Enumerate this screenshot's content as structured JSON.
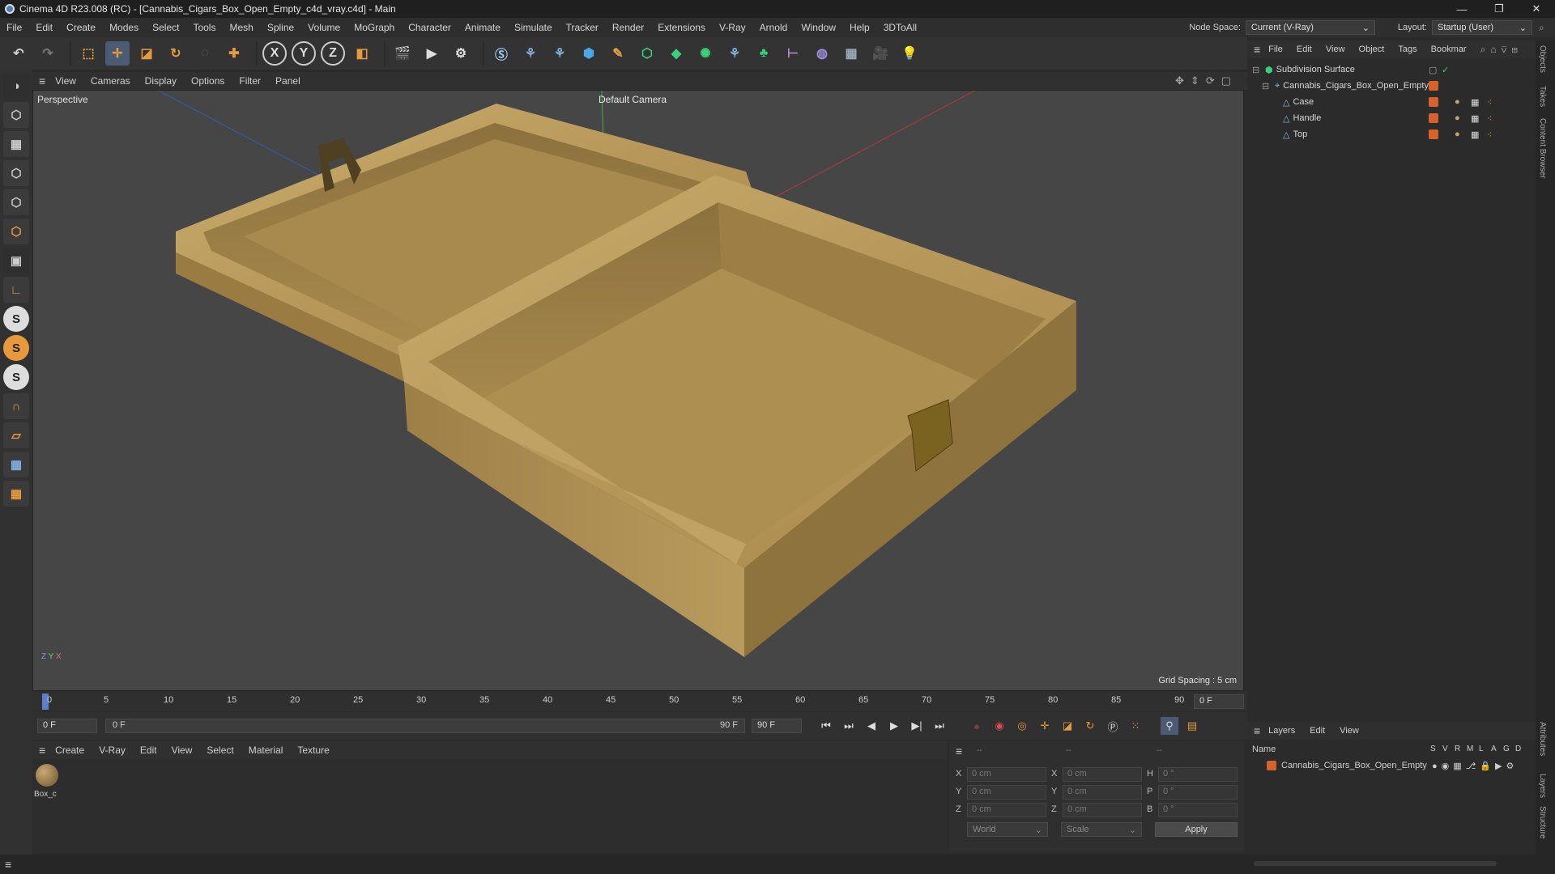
{
  "window": {
    "title": "Cinema 4D R23.008 (RC) - [Cannabis_Cigars_Box_Open_Empty_c4d_vray.c4d] - Main",
    "controls": [
      "—",
      "❐",
      "✕"
    ]
  },
  "menu": {
    "items": [
      "File",
      "Edit",
      "Create",
      "Modes",
      "Select",
      "Tools",
      "Mesh",
      "Spline",
      "Volume",
      "MoGraph",
      "Character",
      "Animate",
      "Simulate",
      "Tracker",
      "Render",
      "Extensions",
      "V-Ray",
      "Arnold",
      "Window",
      "Help",
      "3DToAll"
    ],
    "node_space_label": "Node Space:",
    "node_space_value": "Current (V-Ray)",
    "layout_label": "Layout:",
    "layout_value": "Startup (User)"
  },
  "viewport_menu": {
    "items": [
      "View",
      "Cameras",
      "Display",
      "Options",
      "Filter",
      "Panel"
    ],
    "view_name": "Perspective",
    "camera": "Default Camera",
    "grid_spacing": "Grid Spacing : 5 cm"
  },
  "timeline": {
    "ticks": [
      "0",
      "5",
      "10",
      "15",
      "20",
      "25",
      "30",
      "35",
      "40",
      "45",
      "50",
      "55",
      "60",
      "65",
      "70",
      "75",
      "80",
      "85",
      "90"
    ],
    "current_frame": "0 F",
    "start_field": "0 F",
    "range_start": "0 F",
    "range_end": "90 F",
    "end_field": "90 F"
  },
  "material_menu": {
    "items": [
      "Create",
      "V-Ray",
      "Edit",
      "View",
      "Select",
      "Material",
      "Texture"
    ],
    "material_name": "Box_c"
  },
  "coords": {
    "header_dashes": [
      "--",
      "--",
      "--"
    ],
    "rows": [
      {
        "axis": "X",
        "pos": "0 cm",
        "axis2": "X",
        "size": "0 cm",
        "rot_axis": "H",
        "rot": "0 °"
      },
      {
        "axis": "Y",
        "pos": "0 cm",
        "axis2": "Y",
        "size": "0 cm",
        "rot_axis": "P",
        "rot": "0 °"
      },
      {
        "axis": "Z",
        "pos": "0 cm",
        "axis2": "Z",
        "size": "0 cm",
        "rot_axis": "B",
        "rot": "0 °"
      }
    ],
    "mode1": "World",
    "mode2": "Scale",
    "apply": "Apply"
  },
  "objects_menu": {
    "items": [
      "File",
      "Edit",
      "View",
      "Object",
      "Tags",
      "Bookmar"
    ]
  },
  "objects": [
    {
      "name": "Subdivision Surface",
      "indent": 0
    },
    {
      "name": "Cannabis_Cigars_Box_Open_Empty",
      "indent": 1
    },
    {
      "name": "Case",
      "indent": 2
    },
    {
      "name": "Handle",
      "indent": 2
    },
    {
      "name": "Top",
      "indent": 2
    }
  ],
  "layers_menu": {
    "items": [
      "Layers",
      "Edit",
      "View"
    ],
    "col_name": "Name",
    "col_flags": [
      "S",
      "V",
      "R",
      "M",
      "L",
      "A",
      "G",
      "D"
    ],
    "layer_name": "Cannabis_Cigars_Box_Open_Empty"
  },
  "right_tabs": [
    "Objects",
    "Takes",
    "Content Browser",
    "Attributes",
    "Layers",
    "Structure"
  ],
  "colors": {
    "accent_orange": "#d4622a",
    "wood": "#b89a5c",
    "bg": "#464646"
  }
}
